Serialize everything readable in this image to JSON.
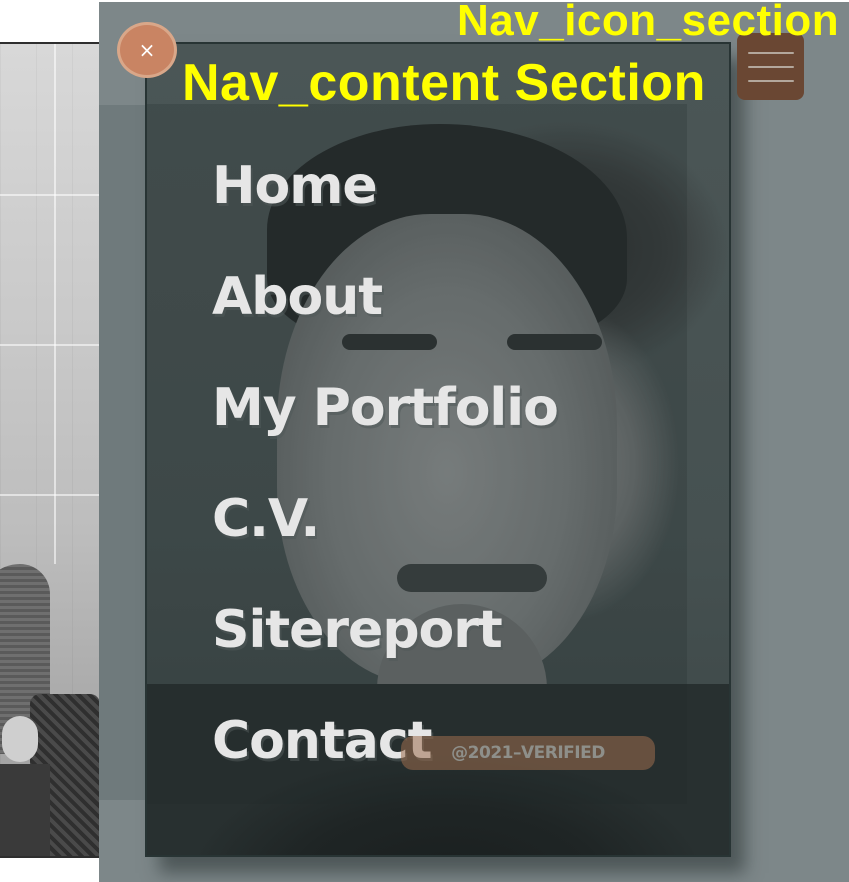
{
  "annotations": {
    "nav_icon_section": "Nav_icon_section",
    "nav_content_section": "Nav_content Section"
  },
  "close_button": {
    "icon": "close-icon",
    "glyph": "×"
  },
  "hamburger": {
    "icon": "hamburger-menu-icon"
  },
  "menu": {
    "items": [
      {
        "label": "Home"
      },
      {
        "label": "About"
      },
      {
        "label": "My Portfolio"
      },
      {
        "label": "C.V."
      },
      {
        "label": "Sitereport"
      },
      {
        "label": "Contact"
      }
    ]
  },
  "badge": {
    "text": "@2021–VERIFIED"
  },
  "colors": {
    "overlay": "#7d8789",
    "close_button": "#c98463",
    "hamburger": "#6a4733",
    "annotation": "#ffff00",
    "menu_text": "#e6e6e6"
  }
}
